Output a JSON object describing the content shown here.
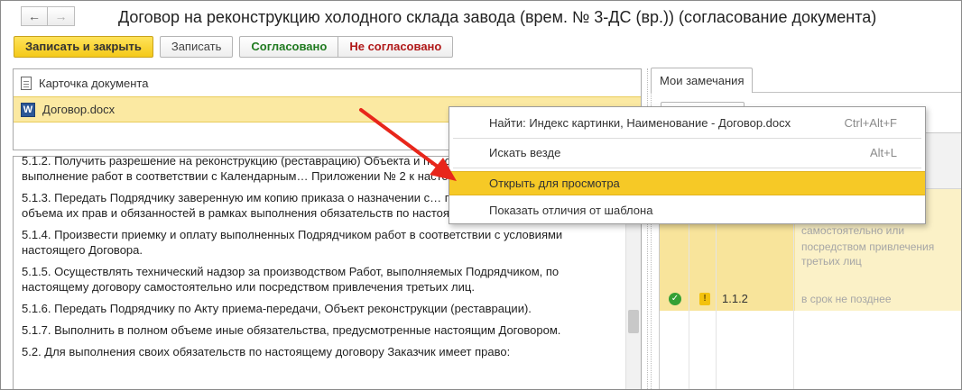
{
  "window": {
    "title": "Договор на реконструкцию холодного склада завода (врем. № 3-ДС (вр.)) (согласование документа)",
    "back_label": "←",
    "forward_label": "→"
  },
  "toolbar": {
    "write_close_label": "Записать и закрыть",
    "write_label": "Записать",
    "approved_label": "Согласовано",
    "not_approved_label": "Не согласовано"
  },
  "files": [
    {
      "icon": "document-icon",
      "label": "Карточка документа"
    },
    {
      "icon": "word-icon",
      "label": "Договор.docx",
      "selected": true
    }
  ],
  "word_icon_letter": "W",
  "document_text": [
    "5.1.2. Получить разрешение на реконструкцию (реставрацию) Объекта и п… срок, обеспечивающий выполнение работ в соответствии с Календарным… Приложении № 2 к настоящему Договору.",
    "5.1.3. Передать Подрядчику заверенную им копию приказа о назначении с… представителей с определением объема их прав и обязанностей в рамках выполнения обязательств по настоящему Договору.",
    "5.1.4. Произвести приемку и оплату выполненных Подрядчиком работ в соответствии с условиями настоящего Договора.",
    "5.1.5. Осуществлять технический надзор за производством Работ, выполняемых Подрядчиком, по настоящему договору самостоятельно или посредством привлечения третьих лиц.",
    "5.1.6. Передать Подрядчику по Акту приема-передачи, Объект реконструкции (реставрации).",
    "5.1.7. Выполнить в полном объеме иные обязательства, предусмотренные настоящим Договором.",
    "5.2. Для выполнения своих обязательств по настоящему договору Заказчик имеет право:"
  ],
  "right_panel": {
    "tab_label": "Мои замечания",
    "comment_1_lines": [
      "самостоятельно или",
      "посредством привлечения",
      "третьих лиц"
    ],
    "row_2": {
      "status_icon": "check-icon",
      "flag_icon": "warning-icon",
      "number": "1.1.2",
      "text": "в срок не позднее"
    }
  },
  "context_menu": {
    "items": [
      {
        "label": "Найти: Индекс картинки, Наименование - Договор.docx",
        "shortcut": "Ctrl+Alt+F"
      },
      {
        "label": "Искать везде",
        "shortcut": "Alt+L"
      },
      {
        "label": "Открыть для просмотра",
        "shortcut": "",
        "highlighted": true
      },
      {
        "label": "Показать отличия от шаблона",
        "shortcut": ""
      }
    ]
  },
  "colors": {
    "primary_button": "#f4c919",
    "selection": "#fbe9a2",
    "menu_highlight": "#f6c926",
    "approved_text": "#1f7a1f",
    "not_approved_text": "#b01818",
    "annotation_arrow": "#e8261b"
  }
}
